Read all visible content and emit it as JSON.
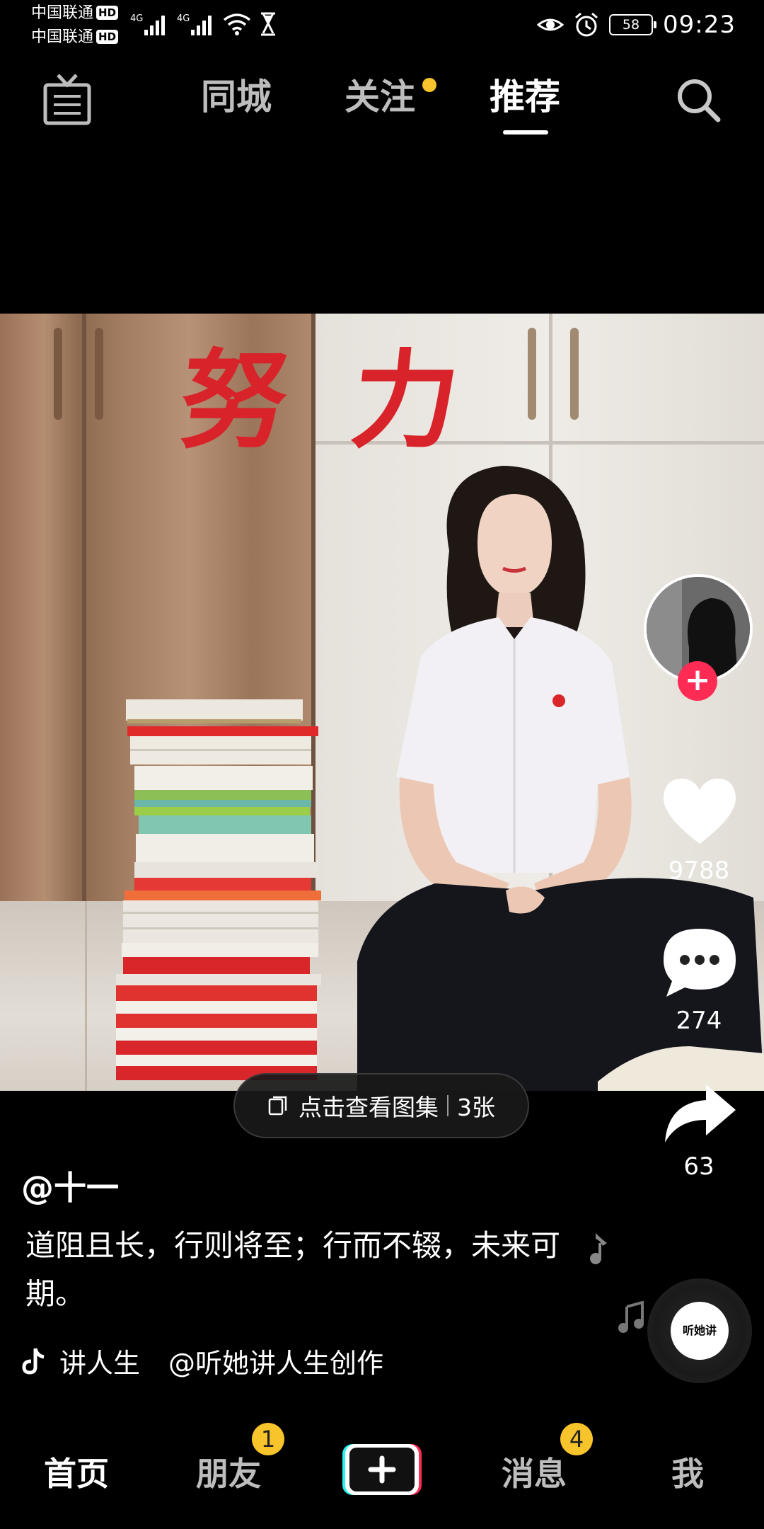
{
  "status_bar": {
    "carrier_1": "中国联通",
    "carrier_2": "中国联通",
    "hd_badge": "HD",
    "network_1": "4G",
    "network_2": "4G",
    "battery_level": "58",
    "time": "09:23"
  },
  "top_nav": {
    "live_icon": "live-tv-icon",
    "tabs": [
      {
        "label": "同城",
        "active": false
      },
      {
        "label": "关注",
        "active": false,
        "has_dot": true
      },
      {
        "label": "推荐",
        "active": true
      }
    ],
    "search_icon": "search-icon"
  },
  "post": {
    "image_text": "努力",
    "likes": "9788",
    "comments": "274",
    "shares": "63",
    "gallery": {
      "label": "点击查看图集",
      "count": "3张"
    },
    "author": "@十一",
    "caption": "道阻且长，行则将至；行而不辍，未来可期。",
    "music_song": "讲人生",
    "music_author": "@听她讲人生创作",
    "disc_label": "听她讲"
  },
  "bottom_nav": {
    "home": "首页",
    "friends": "朋友",
    "friends_badge": "1",
    "create_icon": "plus-icon",
    "messages": "消息",
    "messages_badge": "4",
    "me": "我"
  },
  "colors": {
    "accent_red": "#fe2c55",
    "badge_yellow": "#f8c42b",
    "slogan_red": "#d8232a"
  }
}
